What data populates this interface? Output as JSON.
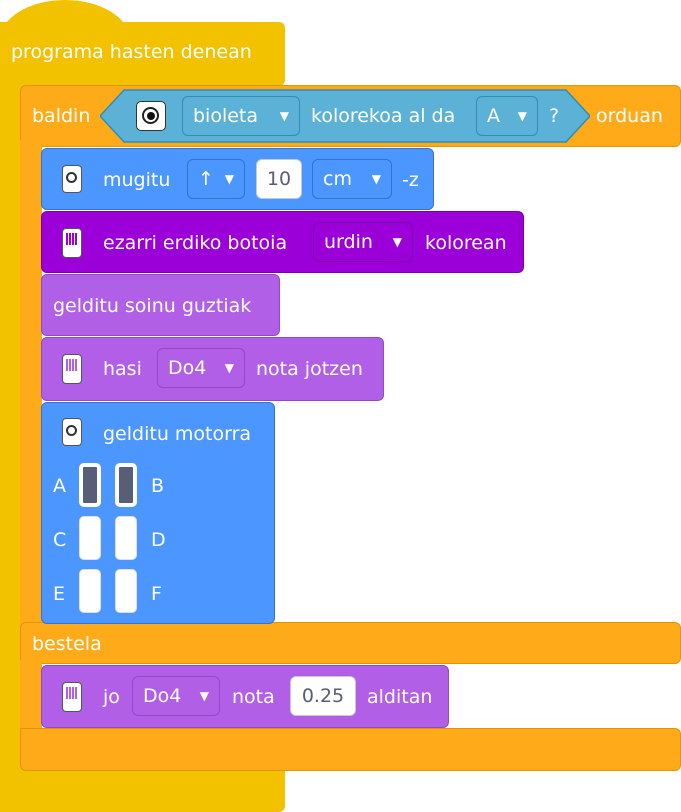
{
  "hat_label": "programa hasten denean",
  "if_block": {
    "label_if": "baldin",
    "label_then": "orduan",
    "label_else": "bestela",
    "condition": {
      "color_option": "bioleta",
      "text_mid": "kolorekoa al da",
      "port_option": "A",
      "question": "?"
    }
  },
  "move_block": {
    "label": "mugitu",
    "direction": "↑",
    "value": "10",
    "unit": "cm",
    "suffix": "-z"
  },
  "set_button_block": {
    "label": "ezarri erdiko botoia",
    "color": "urdin",
    "suffix": "kolorean"
  },
  "stop_sounds_block": {
    "label": "gelditu soinu guztiak"
  },
  "start_note_block": {
    "label": "hasi",
    "note": "Do4",
    "suffix": "nota jotzen"
  },
  "stop_motor_block": {
    "label": "gelditu motorra",
    "ports": [
      {
        "left": "A",
        "right": "B",
        "left_on": true,
        "right_on": true
      },
      {
        "left": "C",
        "right": "D",
        "left_on": false,
        "right_on": false
      },
      {
        "left": "E",
        "right": "F",
        "left_on": false,
        "right_on": false
      }
    ]
  },
  "play_note_block": {
    "label": "jo",
    "note": "Do4",
    "mid": "nota",
    "value": "0.25",
    "suffix": "alditan"
  },
  "colors": {
    "yellow": "#f2c100",
    "orange": "#ffab19",
    "blue": "#4c97ff",
    "dark_purple": "#9c00d9",
    "light_purple": "#b25fe8",
    "condition_teal": "#5cb1d6"
  },
  "icons": [
    "color-sensor-icon",
    "motor-icon",
    "hub-icon",
    "dropdown-arrow-icon"
  ]
}
